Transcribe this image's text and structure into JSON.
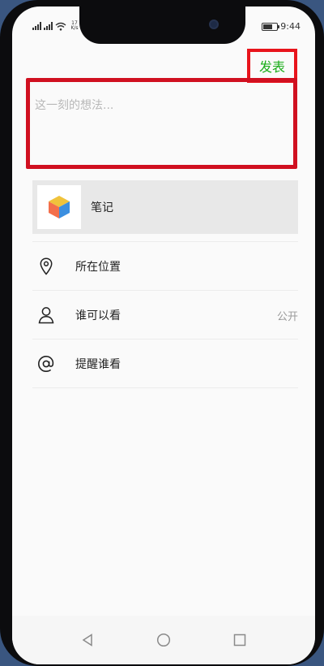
{
  "status_bar": {
    "carrier_signal": "signal-icon",
    "speed_value": "17",
    "speed_unit": "K/s",
    "time": "9:44"
  },
  "header": {
    "publish_label": "发表"
  },
  "composer": {
    "placeholder": "这一刻的想法..."
  },
  "attachment": {
    "label": "笔记",
    "icon": "cube-icon"
  },
  "options": [
    {
      "label": "所在位置",
      "icon": "location-pin-icon",
      "value": ""
    },
    {
      "label": "谁可以看",
      "icon": "person-icon",
      "value": "公开"
    },
    {
      "label": "提醒谁看",
      "icon": "at-icon",
      "value": ""
    }
  ],
  "colors": {
    "accent_green": "#1aad19",
    "highlight_red": "#e8141c",
    "attachment_bg": "#e8e8e8"
  },
  "navigation": {
    "back": "back-triangle-icon",
    "home": "home-circle-icon",
    "recent": "recent-square-icon"
  }
}
